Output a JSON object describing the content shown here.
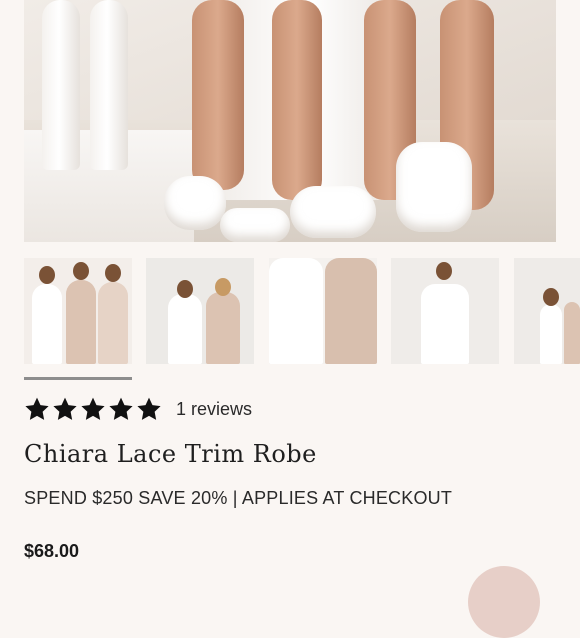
{
  "gallery": {
    "main_image": "product-photo-slippers",
    "thumbnails": [
      "thumb-robes-group-1",
      "thumb-robes-pair-arches",
      "thumb-robe-detail",
      "thumb-robe-model",
      "thumb-robes-group-2"
    ]
  },
  "rating": {
    "stars": 5,
    "reviews_label": "1 reviews"
  },
  "product": {
    "title": "Chiara Lace Trim Robe",
    "promo": "SPEND $250 SAVE 20% | APPLIES AT CHECKOUT",
    "price": "$68.00"
  },
  "colors": {
    "background": "#faf6f3",
    "text": "#1c1c1c",
    "accent_blush": "#e7cfc8",
    "star": "#111111"
  }
}
